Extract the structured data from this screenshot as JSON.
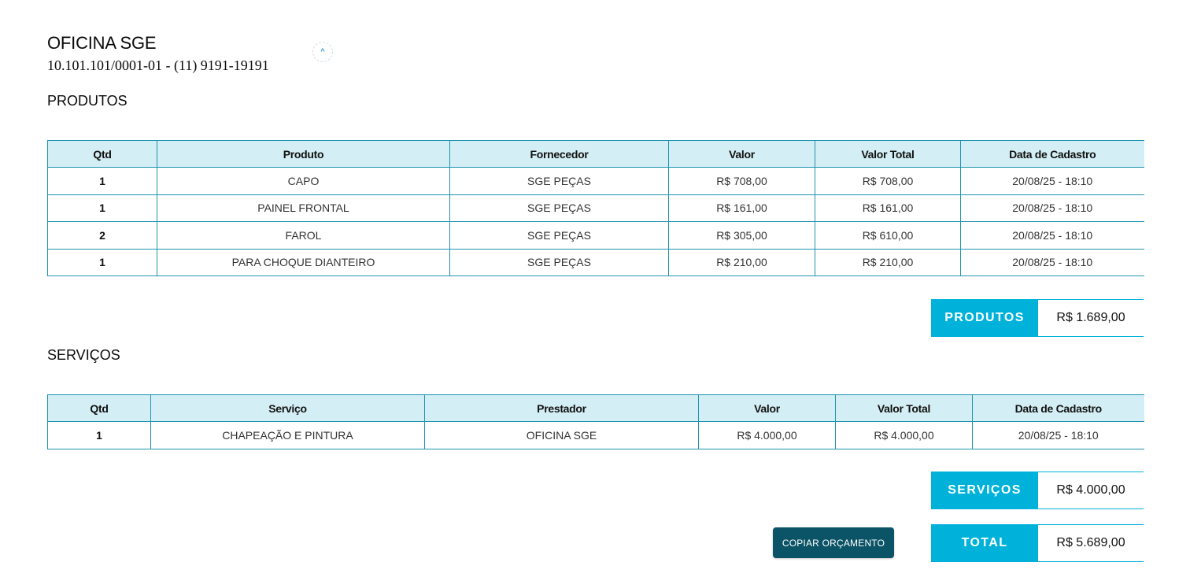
{
  "header": {
    "company_name": "OFICINA SGE",
    "company_info": "10.101.101/0001-01 - (11) 9191-19191",
    "badge_glyph": "^"
  },
  "produtos": {
    "title": "PRODUTOS",
    "columns": [
      "Qtd",
      "Produto",
      "Fornecedor",
      "Valor",
      "Valor Total",
      "Data de Cadastro"
    ],
    "rows": [
      [
        "1",
        "CAPO",
        "SGE PEÇAS",
        "R$ 708,00",
        "R$ 708,00",
        "20/08/25 - 18:10"
      ],
      [
        "1",
        "PAINEL FRONTAL",
        "SGE PEÇAS",
        "R$ 161,00",
        "R$ 161,00",
        "20/08/25 - 18:10"
      ],
      [
        "2",
        "FAROL",
        "SGE PEÇAS",
        "R$ 305,00",
        "R$ 610,00",
        "20/08/25 - 18:10"
      ],
      [
        "1",
        "PARA CHOQUE DIANTEIRO",
        "SGE PEÇAS",
        "R$ 210,00",
        "R$ 210,00",
        "20/08/25 - 18:10"
      ]
    ],
    "total_label": "PRODUTOS",
    "total_value": "R$ 1.689,00"
  },
  "servicos": {
    "title": "SERVIÇOS",
    "columns": [
      "Qtd",
      "Serviço",
      "Prestador",
      "Valor",
      "Valor Total",
      "Data de Cadastro"
    ],
    "rows": [
      [
        "1",
        "CHAPEAÇÃO E PINTURA",
        "OFICINA SGE",
        "R$ 4.000,00",
        "R$ 4.000,00",
        "20/08/25 - 18:10"
      ]
    ],
    "total_label": "SERVIÇOS",
    "total_value": "R$ 4.000,00"
  },
  "total": {
    "label": "TOTAL",
    "value": "R$ 5.689,00"
  },
  "actions": {
    "copy_label": "COPIAR ORÇAMENTO"
  },
  "colors": {
    "accent": "#00b2d9",
    "header_bg": "#d3eef4",
    "border": "#1f93b0",
    "button": "#0b5366"
  }
}
